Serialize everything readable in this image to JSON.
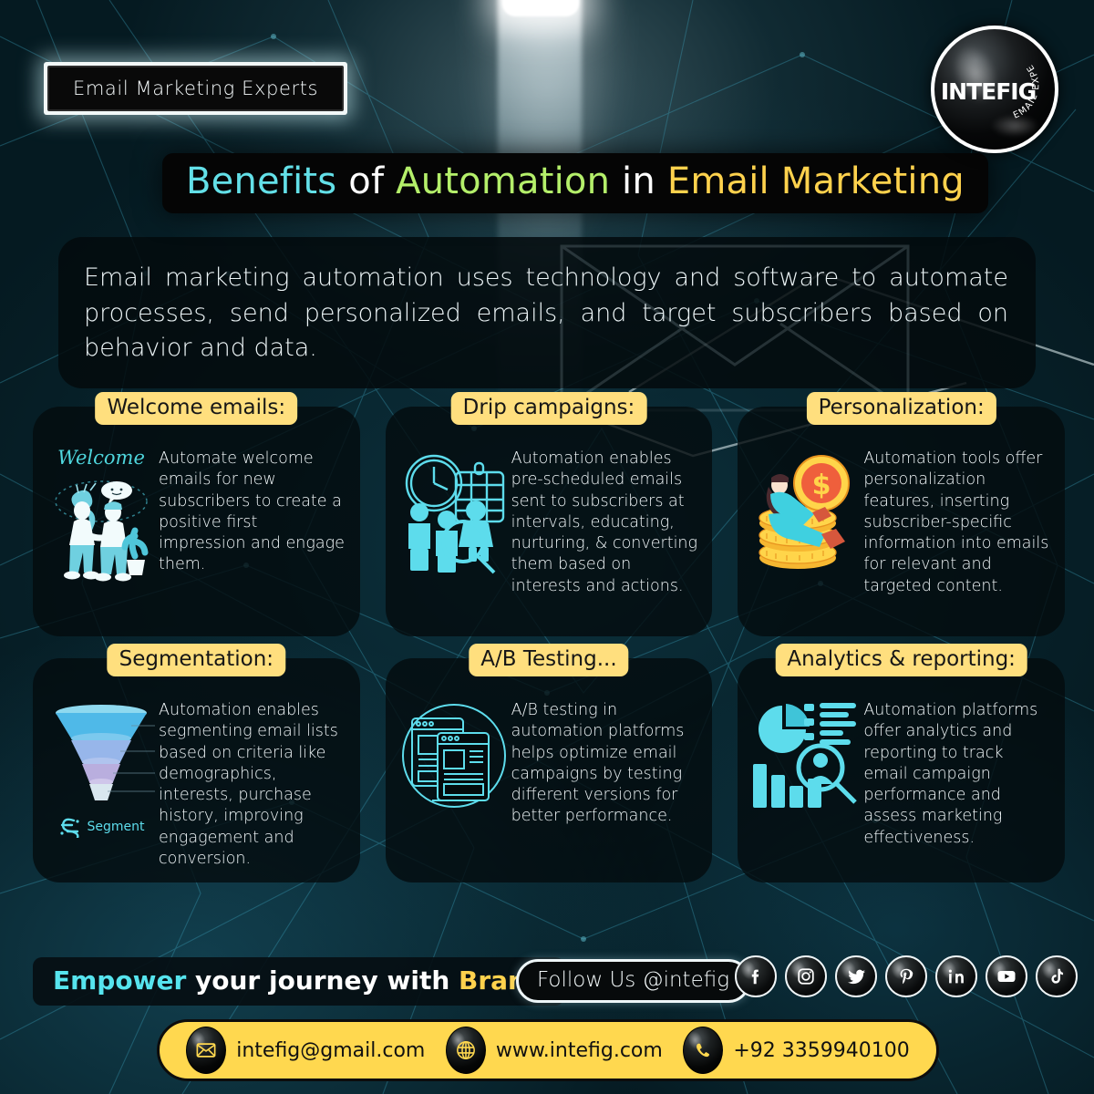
{
  "header": {
    "tagline": "Email Marketing Experts",
    "logo_word": "INTEFIG",
    "logo_arc": "EMAIL EXPERT",
    "title_parts": [
      {
        "text": "Benefits",
        "color": "#63e0e8"
      },
      {
        "text": "of",
        "color": "#ffffff"
      },
      {
        "text": "Automation",
        "color": "#b4ef6a"
      },
      {
        "text": "in",
        "color": "#ffffff"
      },
      {
        "text": "Email Marketing",
        "color": "#ffd24d"
      }
    ]
  },
  "description": "Email marketing automation uses technology and software to automate processes, send personalized emails, and target subscribers based on behavior and data.",
  "cards": [
    {
      "title": "Welcome emails:",
      "body": "Automate welcome emails for new subscribers to create a positive first impression and engage them.",
      "icon": "welcome-handshake-icon",
      "icon_caption": "Welcome"
    },
    {
      "title": "Drip campaigns:",
      "body": "Automation enables pre-scheduled emails sent to subscribers at intervals, educating, nurturing, & converting them based on interests and actions.",
      "icon": "clock-calendar-people-icon",
      "icon_caption": ""
    },
    {
      "title": "Personalization:",
      "body": "Automation tools offer personalization features, inserting subscriber-specific information into emails for relevant and targeted content.",
      "icon": "coins-dollar-person-icon",
      "icon_caption": ""
    },
    {
      "title": "Segmentation:",
      "body": "Automation enables segmenting email lists based on criteria like demographics, interests, purchase history, improving engagement and conversion.",
      "icon": "funnel-segment-icon",
      "icon_caption": "Segment"
    },
    {
      "title": "A/B Testing...",
      "body": "A/B testing in automation platforms helps optimize email campaigns by testing different versions for better performance.",
      "icon": "ab-window-compare-icon",
      "icon_caption": ""
    },
    {
      "title": "Analytics & reporting:",
      "body": "Automation platforms offer analytics and reporting to track email campaign performance and assess marketing effectiveness.",
      "icon": "charts-magnifier-person-icon",
      "icon_caption": ""
    }
  ],
  "footer": {
    "empower_parts": [
      {
        "text": "Empower",
        "color": "#56e4ee"
      },
      {
        "text": "your journey with",
        "color": "#ffffff"
      },
      {
        "text": "Brand",
        "color": "#ffd24d"
      }
    ],
    "follow_label": "Follow Us @intefig",
    "socials": [
      "facebook-icon",
      "instagram-icon",
      "twitter-icon",
      "pinterest-icon",
      "linkedin-icon",
      "youtube-icon",
      "tiktok-icon"
    ],
    "contact": {
      "email": "intefig@gmail.com",
      "website": "www.intefig.com",
      "phone": "+92 3359940100"
    }
  },
  "palette": {
    "background": "#0a2530",
    "card": "#040b0e",
    "accent_yellow": "#ffdf7e",
    "accent_cyan": "#56e4ee",
    "accent_green": "#b4ef6a",
    "accent_gold": "#ffd24d",
    "contact_bar": "#ffd84f"
  }
}
